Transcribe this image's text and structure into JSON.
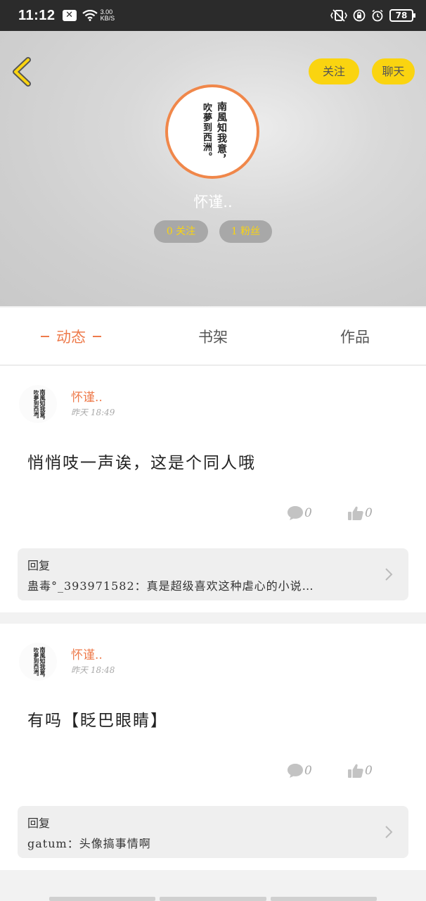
{
  "status_bar": {
    "time": "11:12",
    "speed_value": "3.00",
    "speed_unit": "KB/S",
    "battery": "78"
  },
  "header": {
    "follow_label": "关注",
    "chat_label": "聊天",
    "avatar_lines": [
      "南風知我意，",
      "吹夢到西洲。"
    ],
    "username": "怀谨..",
    "following": "0 关注",
    "fans": "1 粉丝"
  },
  "tabs": {
    "active": "动态",
    "bookshelf": "书架",
    "works": "作品"
  },
  "posts": [
    {
      "name": "怀谨..",
      "time": "昨天 18:49",
      "content": "悄悄吱一声诶，这是个同人哦",
      "comments": "0",
      "likes": "0",
      "reply_title": "回复",
      "reply_text": "蛊毒°_393971582：真是超级喜欢这种虐心的小说…"
    },
    {
      "name": "怀谨..",
      "time": "昨天 18:48",
      "content": "有吗【眨巴眼睛】",
      "comments": "0",
      "likes": "0",
      "reply_title": "回复",
      "reply_text": "gatum：头像搞事情啊"
    }
  ],
  "colors": {
    "accent_orange": "#ee7b4c",
    "button_yellow": "#fad410"
  }
}
